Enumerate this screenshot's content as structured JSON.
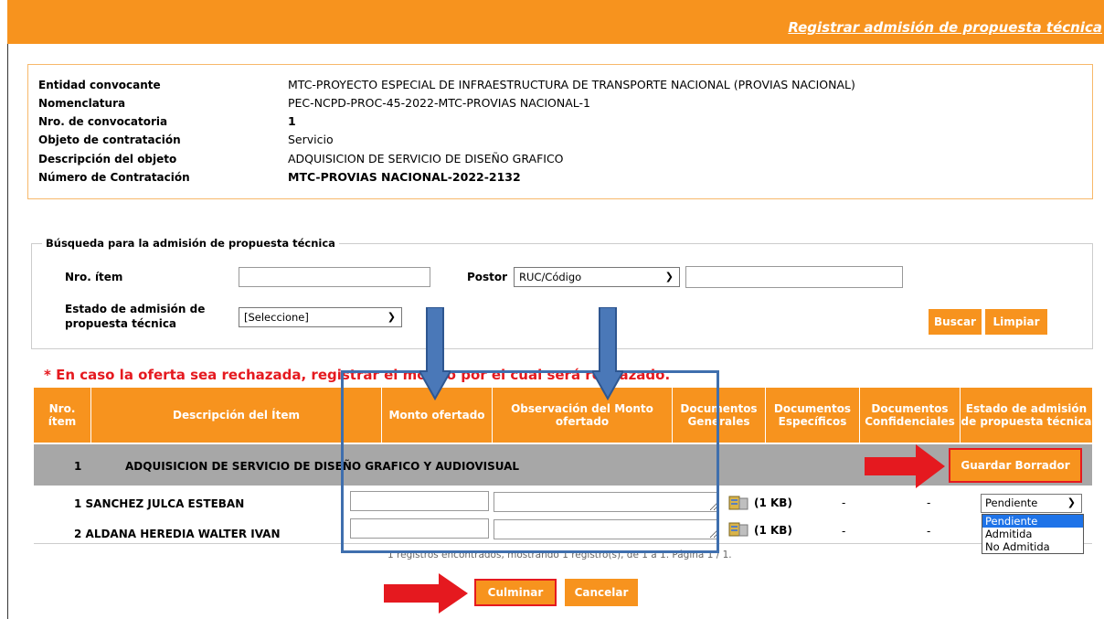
{
  "header": {
    "title": "Registrar admisión de propuesta técnica"
  },
  "info": [
    {
      "label": "Entidad convocante",
      "value": "MTC-PROYECTO ESPECIAL DE INFRAESTRUCTURA DE TRANSPORTE NACIONAL (PROVIAS NACIONAL)"
    },
    {
      "label": "Nomenclatura",
      "value": "PEC-NCPD-PROC-45-2022-MTC-PROVIAS NACIONAL-1"
    },
    {
      "label": "Nro. de convocatoria",
      "value": "1"
    },
    {
      "label": "Objeto de contratación",
      "value": "Servicio"
    },
    {
      "label": "Descripción del objeto",
      "value": "ADQUISICION DE SERVICIO DE DISEÑO GRAFICO"
    },
    {
      "label": "Número de Contratación",
      "value": "MTC-PROVIAS NACIONAL-2022-2132"
    }
  ],
  "search": {
    "legend": "Búsqueda para la admisión de propuesta técnica",
    "item_label": "Nro. ítem",
    "item_value": "",
    "postor_label": "Postor",
    "postor_select": "RUC/Código",
    "postor_value": "",
    "estado_label_1": "Estado de admisión de",
    "estado_label_2": "propuesta técnica",
    "estado_select": "[Seleccione]",
    "buscar": "Buscar",
    "limpiar": "Limpiar"
  },
  "warning": "* En caso la oferta sea rechazada, registrar el motivo por el cual será rechazado.",
  "table": {
    "headers": [
      "Nro. ítem",
      "Descripción del Ítem",
      "Monto ofertado",
      "Observación del Monto ofertado",
      "Documentos Generales",
      "Documentos Específicos",
      "Documentos Confidenciales",
      "Estado de admisión de propuesta técnica"
    ],
    "group": {
      "num": "1",
      "desc": "ADQUISICION DE SERVICIO DE DISEÑO GRAFICO Y AUDIOVISUAL",
      "button": "Guardar Borrador"
    },
    "rows": [
      {
        "name": "1 SANCHEZ JULCA ESTEBAN",
        "doc_size": "(1 KB)",
        "esp": "-",
        "conf": "-",
        "estado": "Pendiente"
      },
      {
        "name": "2 ALDANA HEREDIA WALTER IVAN",
        "doc_size": "(1 KB)",
        "esp": "-",
        "conf": "-",
        "estado": ""
      }
    ],
    "dropdown_options": [
      "Pendiente",
      "Admitida",
      "No Admitida"
    ],
    "footer": "1 registros encontrados, mostrando 1 registro(s), de 1 a 1. Página 1 / 1."
  },
  "actions": {
    "culminar": "Culminar",
    "cancelar": "Cancelar"
  },
  "colors": {
    "accent": "#f7931e",
    "warning": "#e5191f",
    "annotation_blue": "#3f6fae",
    "annotation_red": "#e5191f"
  }
}
